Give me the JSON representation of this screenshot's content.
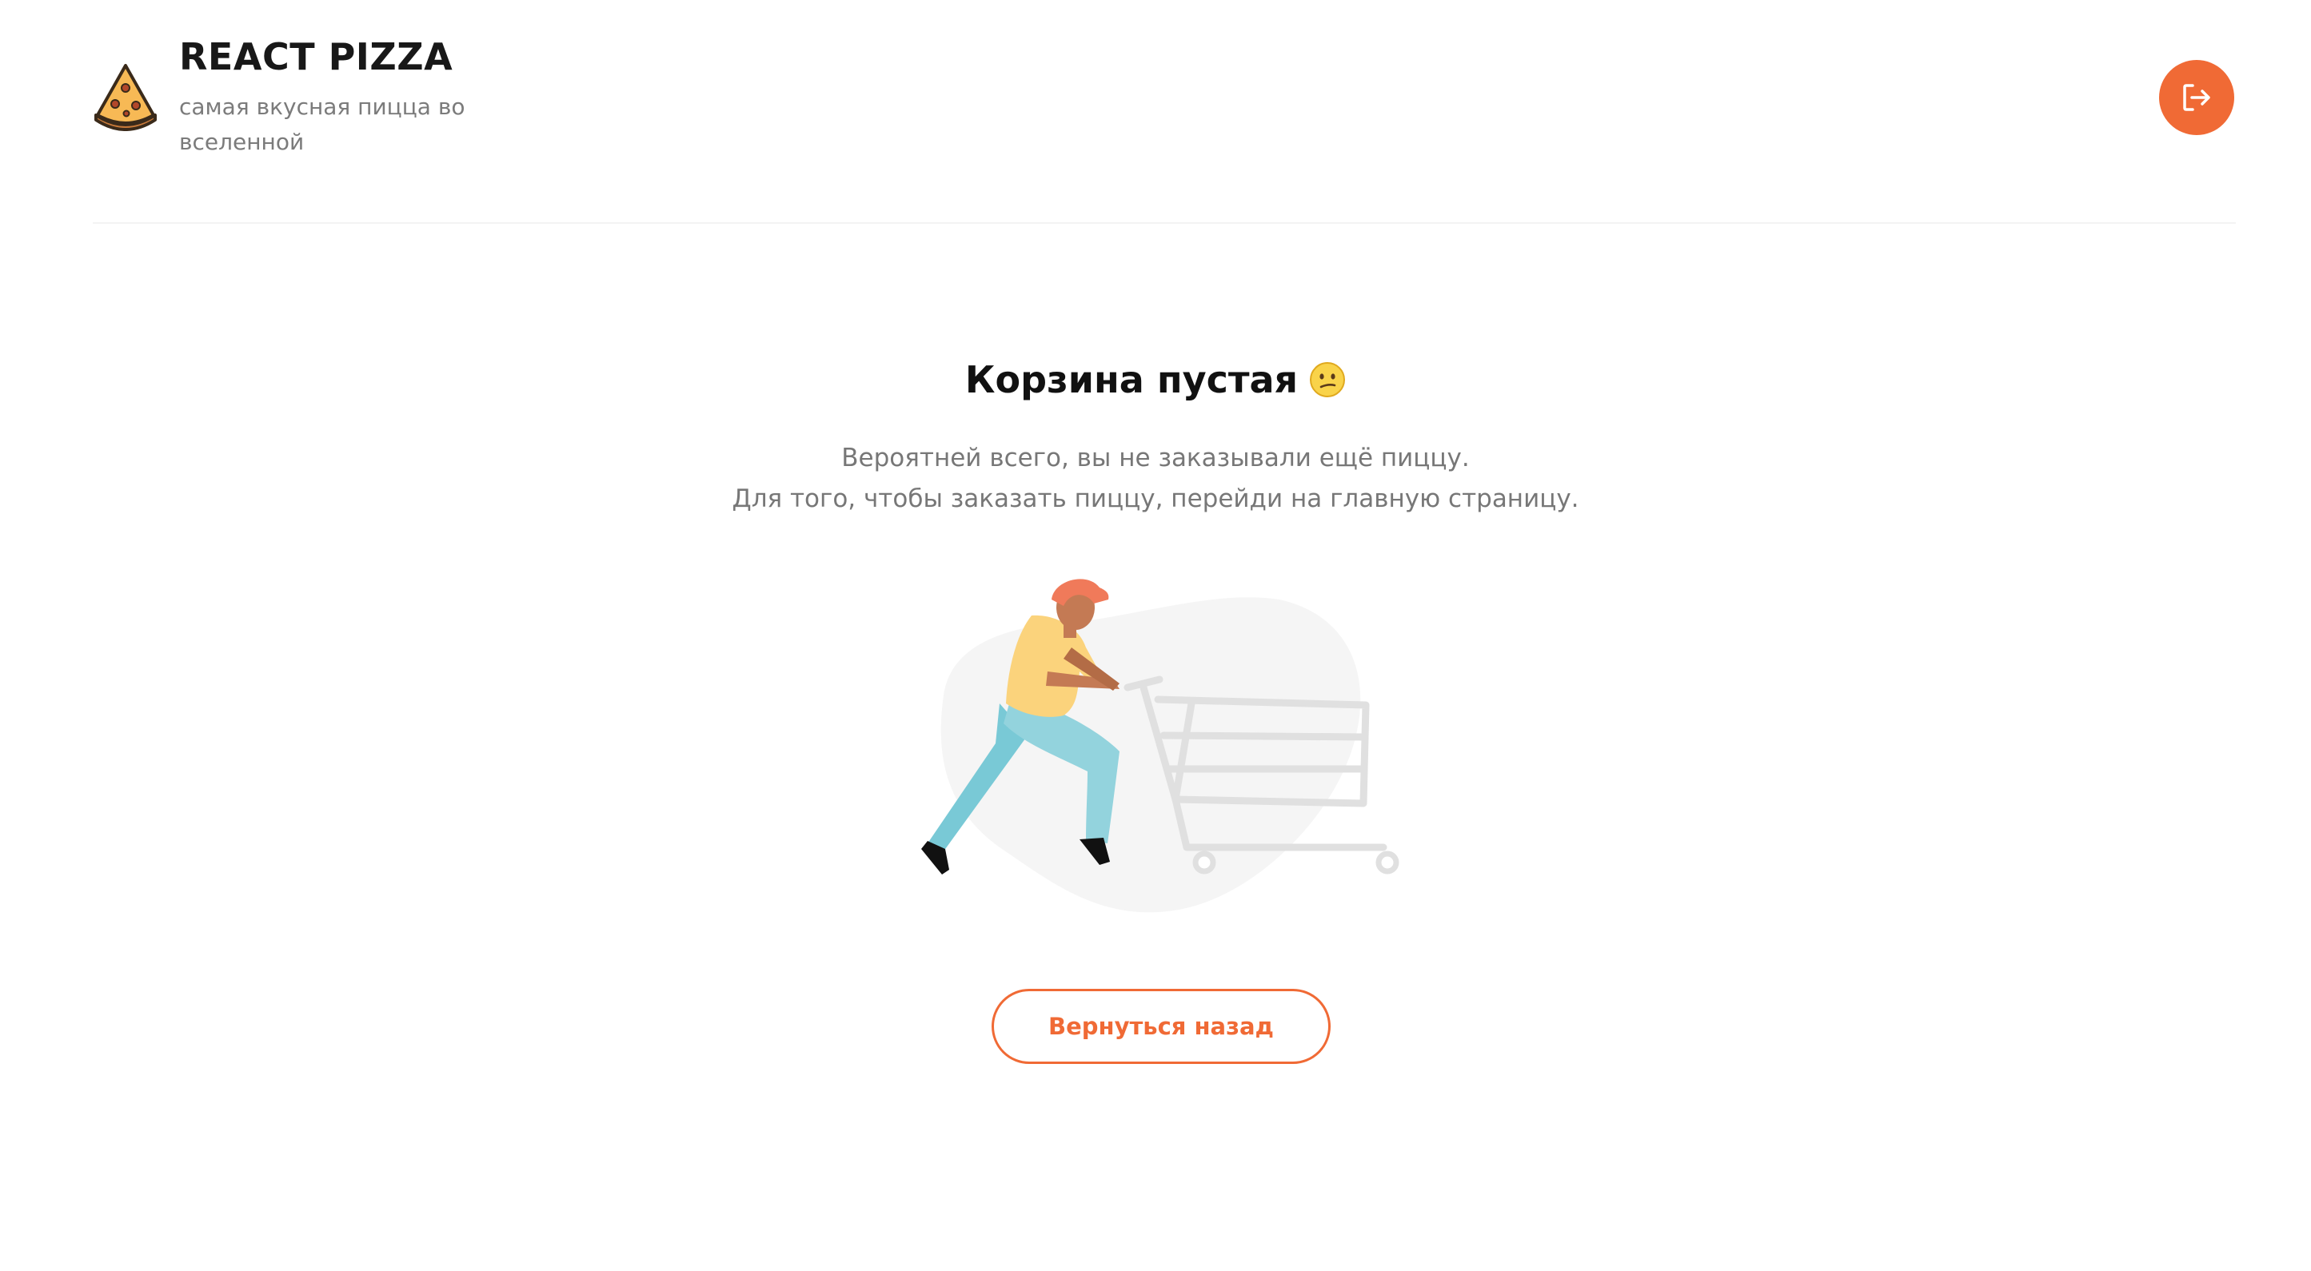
{
  "brand": {
    "title": "REACT PIZZA",
    "subtitle": "самая вкусная пицца во вселенной",
    "logo_icon": "pizza-slice-icon"
  },
  "header": {
    "logout_icon": "logout-icon"
  },
  "cart": {
    "title": "Корзина пустая",
    "emoji_icon": "confused-face-icon",
    "description_line1": "Вероятней всего, вы не заказывали ещё пиццу.",
    "description_line2": "Для того, чтобы заказать пиццу, перейди на главную страницу.",
    "illustration": "person-pushing-empty-cart",
    "back_button_label": "Вернуться назад"
  },
  "colors": {
    "accent": "#f06a35",
    "title_text": "#181818",
    "muted_text": "#777777",
    "divider": "#f3f3f3"
  }
}
